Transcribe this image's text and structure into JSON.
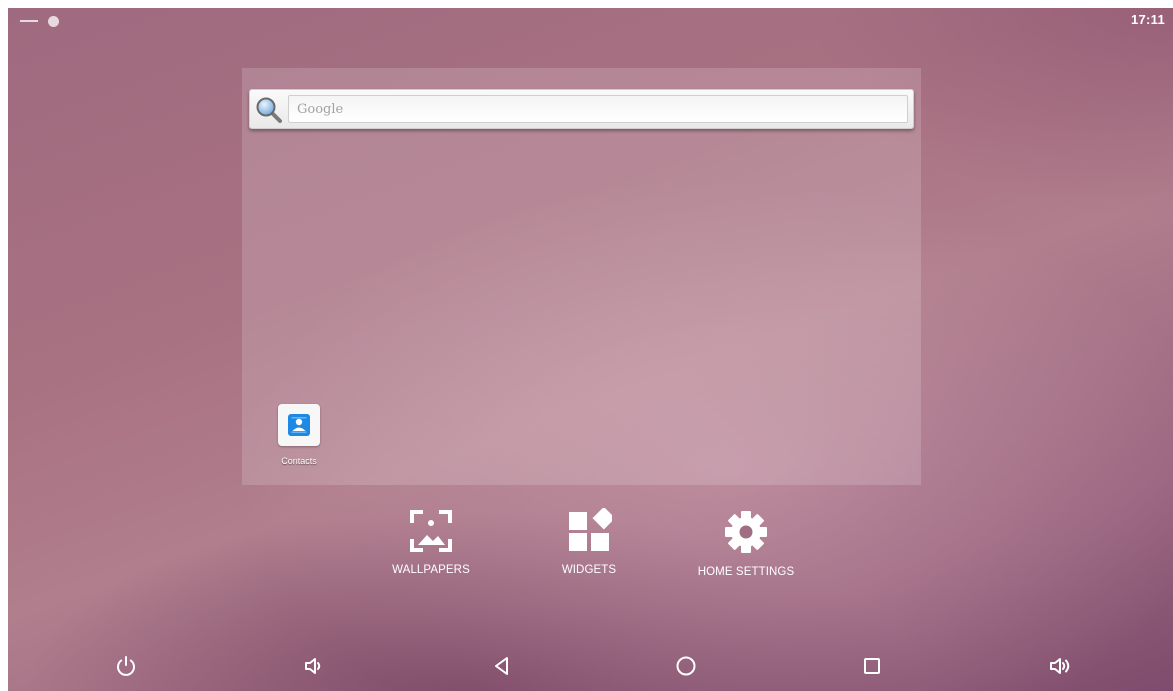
{
  "status_bar": {
    "time": "17:11"
  },
  "search": {
    "placeholder": "Google"
  },
  "apps": [
    {
      "label": "Contacts",
      "icon": "contacts-icon"
    }
  ],
  "overview_actions": [
    {
      "label": "WALLPAPERS",
      "icon": "wallpaper-icon"
    },
    {
      "label": "WIDGETS",
      "icon": "widgets-icon"
    },
    {
      "label": "HOME SETTINGS",
      "icon": "gear-icon"
    }
  ],
  "nav_bar": [
    {
      "icon": "power-icon"
    },
    {
      "icon": "volume-down-icon"
    },
    {
      "icon": "back-icon"
    },
    {
      "icon": "home-icon"
    },
    {
      "icon": "recents-icon"
    },
    {
      "icon": "volume-up-icon"
    }
  ],
  "colors": {
    "contacts_blue": "#1e88e5",
    "search_text": "#9a9a9a"
  }
}
